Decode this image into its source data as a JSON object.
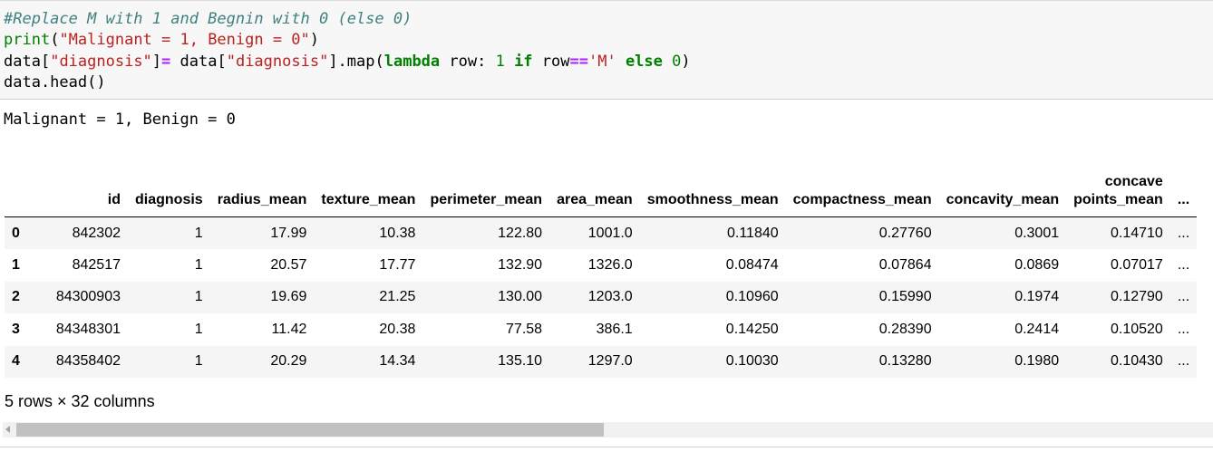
{
  "code_cell": {
    "line1": {
      "comment": "#Replace M with 1 and Begnin with 0 (else 0)"
    },
    "line2": {
      "func": "print",
      "open": "(",
      "arg": "\"Malignant = 1, Benign = 0\"",
      "close": ")"
    },
    "line3": {
      "lhs_name": "data",
      "lhs_open": "[",
      "lhs_key": "\"diagnosis\"",
      "lhs_close": "]",
      "assign": "=",
      "rhs_prefix": " data[",
      "rhs_key": "\"diagnosis\"",
      "rhs_mid": "].map(",
      "kw_lambda": "lambda",
      "lambda_arg": " row: ",
      "num_one": "1",
      "kw_if": " if",
      "row_name": " row",
      "eq_op": "==",
      "char_m": "'M'",
      "kw_else": " else",
      "space": " ",
      "num_zero": "0",
      "close": ")"
    },
    "line4": {
      "text": "data.head()"
    }
  },
  "stdout": "Malignant = 1, Benign = 0",
  "dataframe": {
    "columns": [
      "",
      "id",
      "diagnosis",
      "radius_mean",
      "texture_mean",
      "perimeter_mean",
      "area_mean",
      "smoothness_mean",
      "compactness_mean",
      "concavity_mean",
      "concave points_mean",
      "..."
    ],
    "concave_line1": "concave",
    "concave_line2": "points_mean",
    "rows": [
      [
        "0",
        "842302",
        "1",
        "17.99",
        "10.38",
        "122.80",
        "1001.0",
        "0.11840",
        "0.27760",
        "0.3001",
        "0.14710",
        "..."
      ],
      [
        "1",
        "842517",
        "1",
        "20.57",
        "17.77",
        "132.90",
        "1326.0",
        "0.08474",
        "0.07864",
        "0.0869",
        "0.07017",
        "..."
      ],
      [
        "2",
        "84300903",
        "1",
        "19.69",
        "21.25",
        "130.00",
        "1203.0",
        "0.10960",
        "0.15990",
        "0.1974",
        "0.12790",
        "..."
      ],
      [
        "3",
        "84348301",
        "1",
        "11.42",
        "20.38",
        "77.58",
        "386.1",
        "0.14250",
        "0.28390",
        "0.2414",
        "0.10520",
        "..."
      ],
      [
        "4",
        "84358402",
        "1",
        "20.29",
        "14.34",
        "135.10",
        "1297.0",
        "0.10030",
        "0.13280",
        "0.1980",
        "0.10430",
        "..."
      ]
    ],
    "summary": "5 rows × 32 columns"
  },
  "scrollbar": {
    "thumb_fraction": 0.49
  },
  "colors": {
    "comment": "#408080",
    "builtin": "#008000",
    "string": "#ba2121",
    "operator": "#aa22ff",
    "cell_bg": "#f7f7f7",
    "row_stripe": "#f5f5f5"
  }
}
